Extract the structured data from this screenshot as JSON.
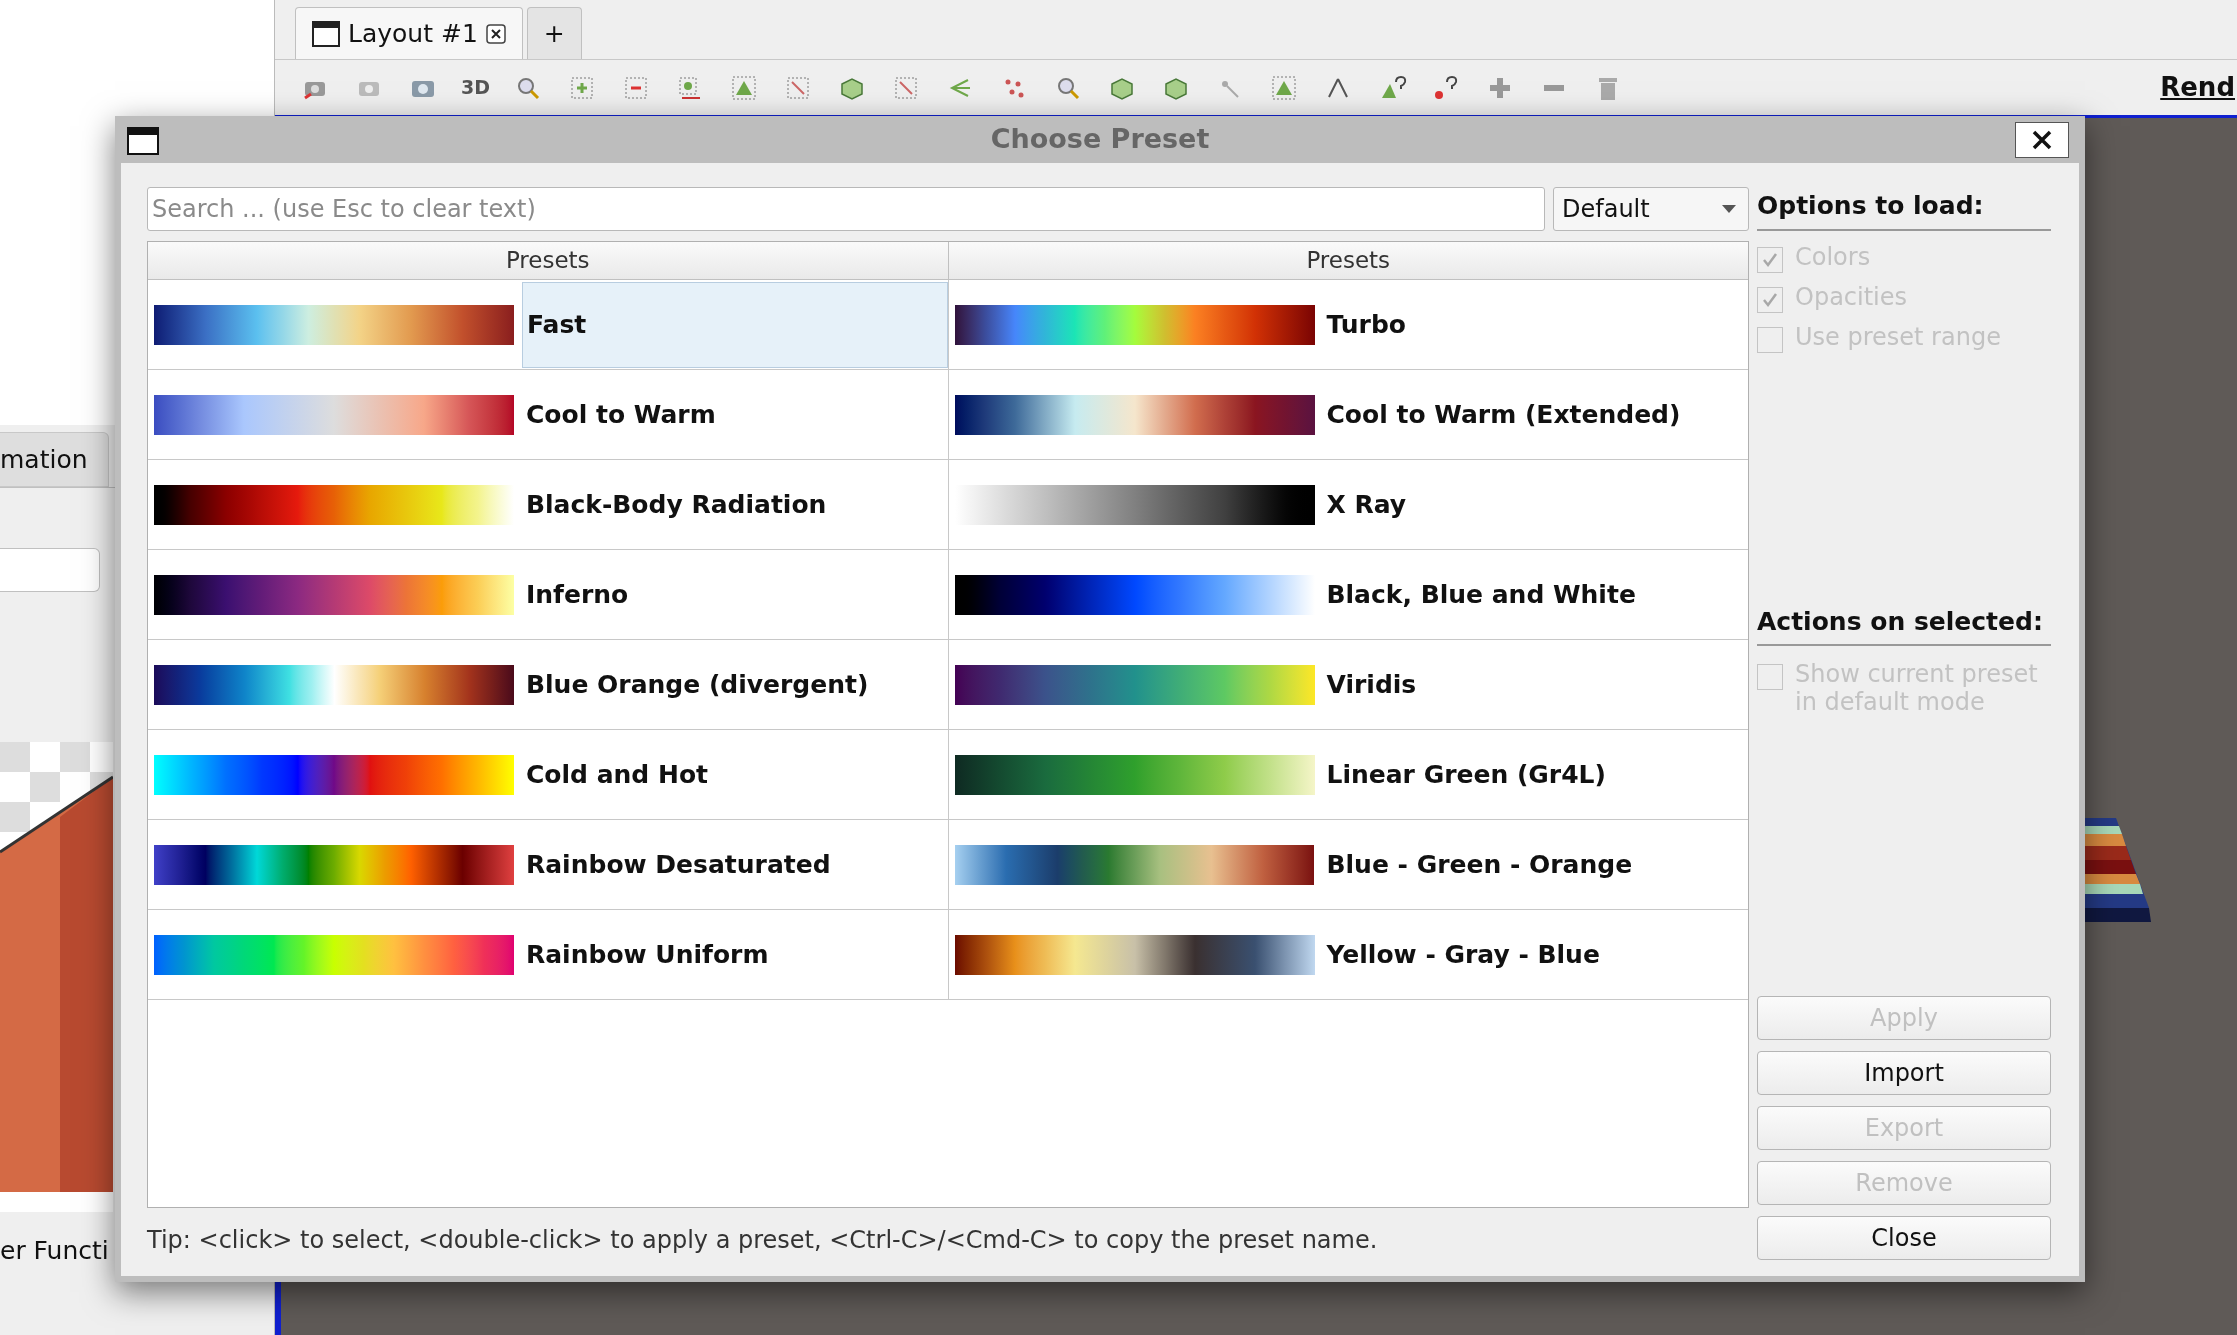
{
  "left_panel": {
    "tab": "mation",
    "footer_label": "er Functi"
  },
  "tabs": [
    {
      "label": "Layout #1",
      "selected": true,
      "kind": "layout"
    },
    {
      "label": "+",
      "selected": false,
      "kind": "new"
    }
  ],
  "toolbar": {
    "view_label": "3D",
    "render_link": "Rend"
  },
  "dialog": {
    "title": "Choose Preset",
    "search": {
      "placeholder": "Search ... (use Esc to clear text)"
    },
    "mode_dropdown": {
      "value": "Default"
    },
    "columns": [
      "Presets",
      "Presets"
    ],
    "presets": [
      {
        "name": "Fast",
        "selected": true,
        "stops": [
          {
            "color": "#0f1b73"
          },
          {
            "color": "#3b6fc4"
          },
          {
            "color": "#5bc0ef"
          },
          {
            "color": "#cdeee0"
          },
          {
            "color": "#f3d387"
          },
          {
            "color": "#e29a4f"
          },
          {
            "color": "#c2502c"
          },
          {
            "color": "#8a1e1e"
          }
        ]
      },
      {
        "name": "Turbo",
        "selected": false,
        "stops": [
          {
            "color": "#30123b"
          },
          {
            "color": "#4686fb"
          },
          {
            "color": "#1be5b5"
          },
          {
            "color": "#a4fc3c"
          },
          {
            "color": "#fb8022"
          },
          {
            "color": "#d23105"
          },
          {
            "color": "#7a0403"
          }
        ]
      },
      {
        "name": "Cool to Warm",
        "selected": false,
        "stops": [
          {
            "color": "#3b4cc0"
          },
          {
            "color": "#aac7fd"
          },
          {
            "color": "#dddddd"
          },
          {
            "color": "#f7a789"
          },
          {
            "color": "#b40426"
          }
        ]
      },
      {
        "name": "Cool to Warm (Extended)",
        "selected": false,
        "stops": [
          {
            "color": "#000b5c"
          },
          {
            "color": "#3e6a99"
          },
          {
            "color": "#c6ebf0"
          },
          {
            "color": "#f5e6cc"
          },
          {
            "color": "#d16d4e"
          },
          {
            "color": "#8b1520"
          },
          {
            "color": "#5a1240"
          }
        ]
      },
      {
        "name": "Black-Body Radiation",
        "selected": false,
        "stops": [
          {
            "color": "#000000"
          },
          {
            "color": "#8b0000"
          },
          {
            "color": "#e61a0d"
          },
          {
            "color": "#e8a600"
          },
          {
            "color": "#e8e81a"
          },
          {
            "color": "#ffffff"
          }
        ]
      },
      {
        "name": "X Ray",
        "selected": false,
        "stops": [
          {
            "color": "#ffffff"
          },
          {
            "color": "#808080"
          },
          {
            "color": "#000000"
          }
        ]
      },
      {
        "name": "Inferno",
        "selected": false,
        "stops": [
          {
            "color": "#000004"
          },
          {
            "color": "#3b0f70"
          },
          {
            "color": "#8c2981"
          },
          {
            "color": "#dd4a68"
          },
          {
            "color": "#fb9d07"
          },
          {
            "color": "#fcffa4"
          }
        ]
      },
      {
        "name": "Black, Blue and White",
        "selected": false,
        "stops": [
          {
            "color": "#000000"
          },
          {
            "color": "#00006e"
          },
          {
            "color": "#0048ff"
          },
          {
            "color": "#64a8ff"
          },
          {
            "color": "#ffffff"
          }
        ]
      },
      {
        "name": "Blue Orange (divergent)",
        "selected": false,
        "stops": [
          {
            "color": "#1b0a59"
          },
          {
            "color": "#0a3a9c"
          },
          {
            "color": "#0f84c9"
          },
          {
            "color": "#3fe0e2"
          },
          {
            "color": "#ffffff"
          },
          {
            "color": "#f5d078"
          },
          {
            "color": "#d7812e"
          },
          {
            "color": "#a3331c"
          },
          {
            "color": "#4a0a1a"
          }
        ]
      },
      {
        "name": "Viridis",
        "selected": false,
        "stops": [
          {
            "color": "#440154"
          },
          {
            "color": "#3b528b"
          },
          {
            "color": "#21918c"
          },
          {
            "color": "#5ec962"
          },
          {
            "color": "#fde725"
          }
        ]
      },
      {
        "name": "Cold and Hot",
        "selected": false,
        "stops": [
          {
            "color": "#00ffff"
          },
          {
            "color": "#0070ff"
          },
          {
            "color": "#0000ff"
          },
          {
            "color": "#e01010"
          },
          {
            "color": "#ff7000"
          },
          {
            "color": "#ffff00"
          }
        ]
      },
      {
        "name": "Linear Green (Gr4L)",
        "selected": false,
        "stops": [
          {
            "color": "#0e2a22"
          },
          {
            "color": "#1a6b3e"
          },
          {
            "color": "#2fa02c"
          },
          {
            "color": "#8fcc4a"
          },
          {
            "color": "#f5f5c8"
          }
        ]
      },
      {
        "name": "Rainbow Desaturated",
        "selected": false,
        "stops": [
          {
            "color": "#4040c8"
          },
          {
            "color": "#000060"
          },
          {
            "color": "#00d8d8"
          },
          {
            "color": "#008000"
          },
          {
            "color": "#d8d800"
          },
          {
            "color": "#ff6000"
          },
          {
            "color": "#6b0000"
          },
          {
            "color": "#e04040"
          }
        ]
      },
      {
        "name": "Blue - Green - Orange",
        "selected": false,
        "stops": [
          {
            "color": "#a6d0f0"
          },
          {
            "color": "#2a6db0"
          },
          {
            "color": "#1b3d6b"
          },
          {
            "color": "#2a7a30"
          },
          {
            "color": "#a8c080"
          },
          {
            "color": "#e8c090"
          },
          {
            "color": "#c06040"
          },
          {
            "color": "#7a1010"
          }
        ]
      },
      {
        "name": "Rainbow Uniform",
        "selected": false,
        "stops": [
          {
            "color": "#0060ff"
          },
          {
            "color": "#00c8a0"
          },
          {
            "color": "#00e850"
          },
          {
            "color": "#c8ff00"
          },
          {
            "color": "#ffc040"
          },
          {
            "color": "#ff6040"
          },
          {
            "color": "#e00070"
          }
        ]
      },
      {
        "name": "Yellow - Gray - Blue",
        "selected": false,
        "stops": [
          {
            "color": "#6b0a00"
          },
          {
            "color": "#e8901a"
          },
          {
            "color": "#f5e890"
          },
          {
            "color": "#c8c0a8"
          },
          {
            "color": "#3a3030"
          },
          {
            "color": "#3a5070"
          },
          {
            "color": "#c0d8f0"
          }
        ]
      }
    ],
    "options": {
      "heading": "Options to load:",
      "items": [
        {
          "label": "Colors",
          "checked": true,
          "disabled": true
        },
        {
          "label": "Opacities",
          "checked": true,
          "disabled": true
        },
        {
          "label": "Use preset range",
          "checked": false,
          "disabled": true
        }
      ]
    },
    "actions": {
      "heading": "Actions on selected:",
      "items": [
        {
          "label": "Show current preset in default mode",
          "checked": false,
          "disabled": true
        }
      ]
    },
    "buttons": [
      {
        "label": "Apply",
        "disabled": true
      },
      {
        "label": "Import",
        "disabled": false
      },
      {
        "label": "Export",
        "disabled": true
      },
      {
        "label": "Remove",
        "disabled": true
      },
      {
        "label": "Close",
        "disabled": false
      }
    ],
    "tip": "Tip: <click> to select, <double-click> to apply a preset, <Ctrl-C>/<Cmd-C> to copy the preset name."
  }
}
